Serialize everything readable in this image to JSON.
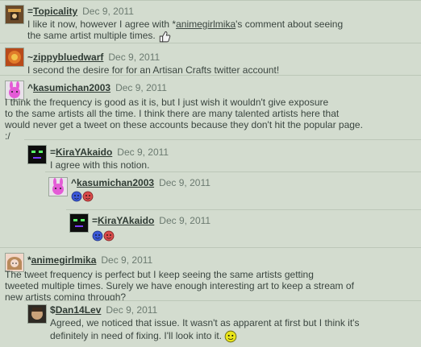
{
  "comments": [
    {
      "symbol": "=",
      "username": "Topicality",
      "date": "Dec 9, 2011",
      "avatar_icon": "deviant-avatar-icon",
      "text_prefix": "I like it now, however I agree with ",
      "mention_symbol": "*",
      "mention": "animegirlmika",
      "text_suffix": "'s comment about seeing",
      "text_line2": "the same artist multiple times."
    },
    {
      "symbol": "~",
      "username": "zippybluedwarf",
      "date": "Dec 9, 2011",
      "avatar_icon": "sun-avatar-icon",
      "text_line1": "I second the desire for for an Artisan Crafts twitter account!"
    },
    {
      "symbol": "^",
      "username": "kasumichan2003",
      "date": "Dec 9, 2011",
      "avatar_icon": "bunny-avatar-icon",
      "text_line1": "I think the frequency is good as it is, but I just wish it wouldn't give exposure",
      "text_line2": "to the same artists all the time. I think there are many talented artists here that",
      "text_line3": "would never get a tweet on these accounts because they don't hit the popular page.",
      "text_line4": ":/"
    },
    {
      "symbol": "=",
      "username": "KiraYAkaido",
      "date": "Dec 9, 2011",
      "avatar_icon": "pixel-avatar-icon",
      "text_line1": "I agree with this notion."
    },
    {
      "symbol": "^",
      "username": "kasumichan2003",
      "date": "Dec 9, 2011",
      "avatar_icon": "bunny-avatar-icon"
    },
    {
      "symbol": "=",
      "username": "KiraYAkaido",
      "date": "Dec 9, 2011",
      "avatar_icon": "pixel-avatar-icon"
    },
    {
      "symbol": "*",
      "username": "animegirlmika",
      "date": "Dec 9, 2011",
      "avatar_icon": "girl-avatar-icon",
      "text_line1": "The tweet frequency is perfect but I keep seeing the same artists getting",
      "text_line2": "tweeted multiple times. Surely we have enough interesting art to keep a stream of",
      "text_line3": "new artists coming through?"
    },
    {
      "symbol": "$",
      "username": "Dan14Lev",
      "date": "Dec 9, 2011",
      "avatar_icon": "face-avatar-icon",
      "text_line1": "Agreed, we noticed that issue. It wasn't as apparent at first but I think it's",
      "text_line2": "definitely in need of fixing. I'll look into it."
    }
  ]
}
